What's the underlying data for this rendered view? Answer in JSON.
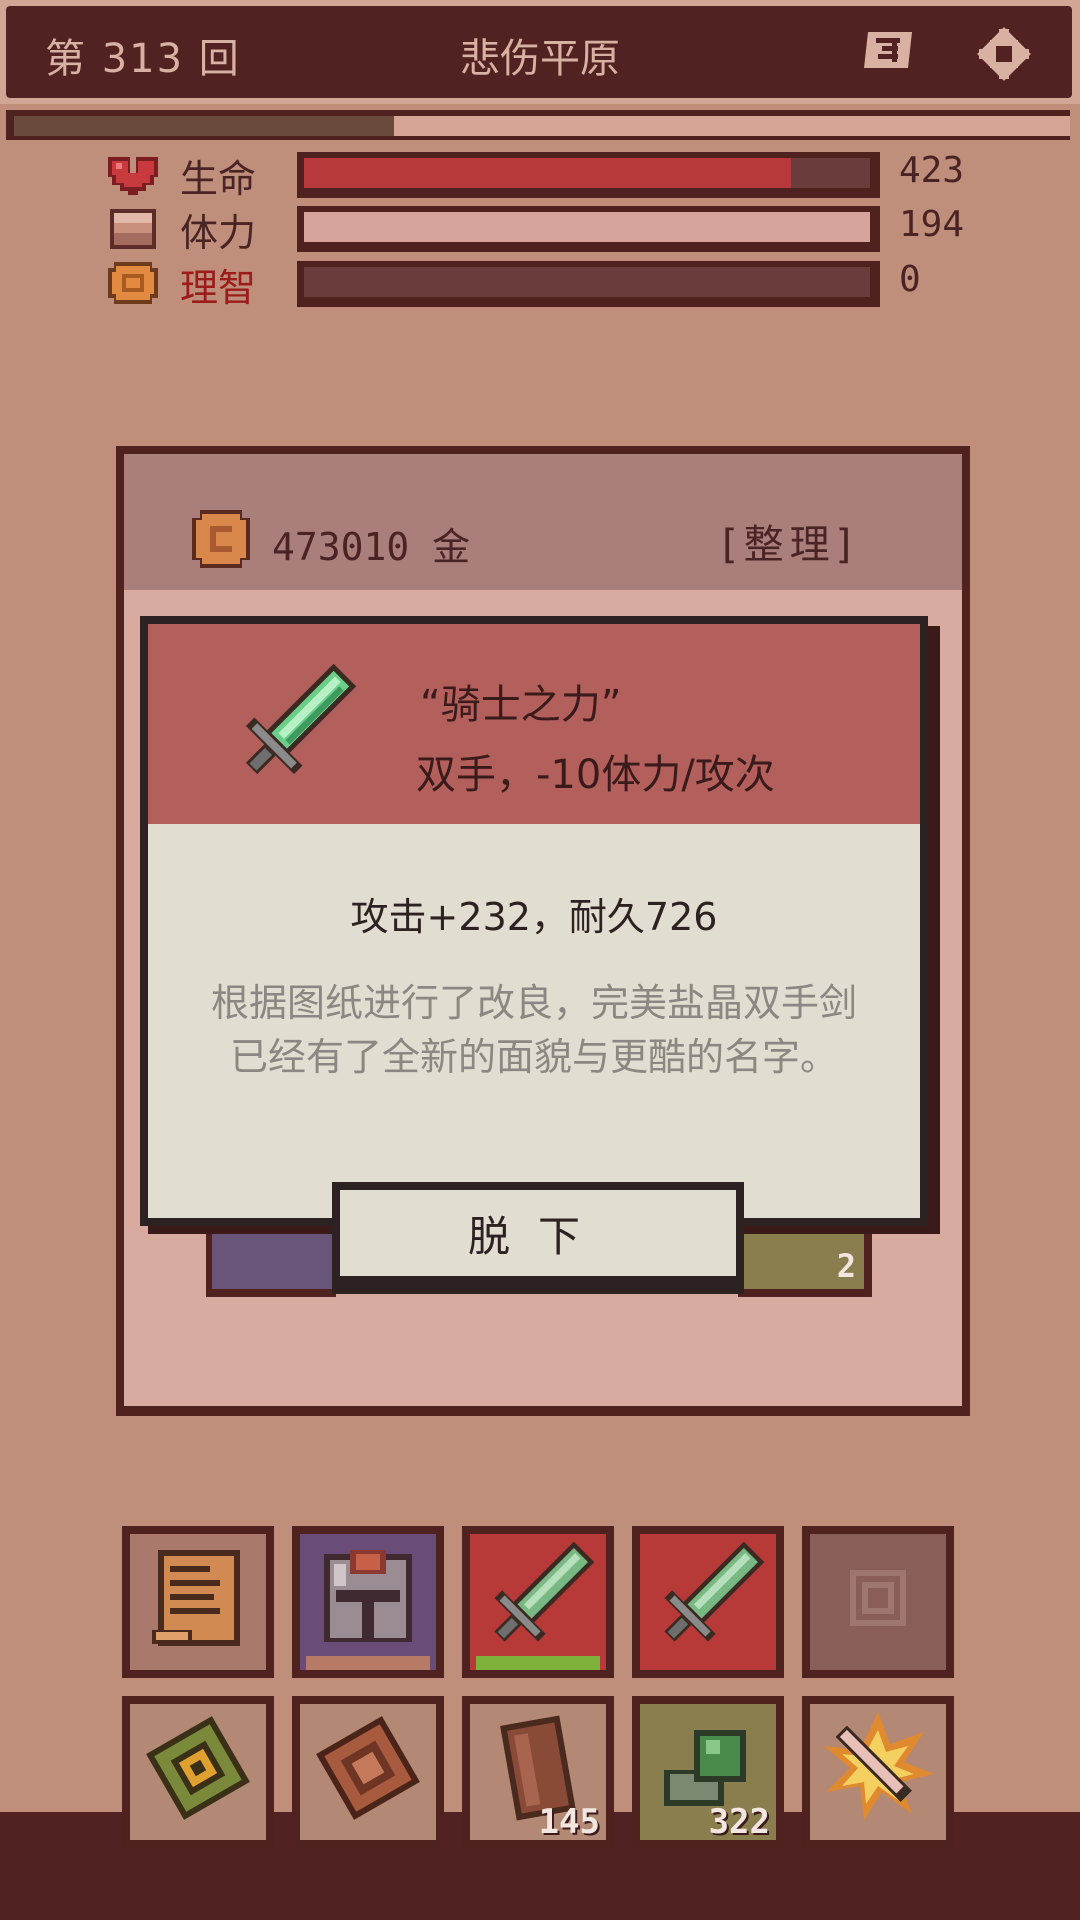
{
  "header": {
    "round_prefix": "第",
    "round_number": "313",
    "round_suffix": "回",
    "location": "悲伤平原",
    "map_icon": "map-icon",
    "settings_icon": "gear-icon"
  },
  "journey_progress": 0.36,
  "stats": [
    {
      "key": "hp",
      "label": "生命",
      "value": "423",
      "fill": 0.86,
      "icon": "heart-icon",
      "fill_color": "#b8393b",
      "back_color": "#6b3c3c",
      "label_color": "#4a2424"
    },
    {
      "key": "stamina",
      "label": "体力",
      "value": "194",
      "fill": 1.0,
      "icon": "stamina-icon",
      "fill_color": "#d6a49b",
      "back_color": "#6b3c3c",
      "label_color": "#4a2424"
    },
    {
      "key": "sanity",
      "label": "理智",
      "value": "0",
      "fill": 0.0,
      "icon": "brain-icon",
      "fill_color": "#b8393b",
      "back_color": "#6b3c3c",
      "label_color": "#9c1b1b"
    }
  ],
  "inventory": {
    "gold": "473010 金",
    "sort_label": "[整理]",
    "hidden_row": [
      {
        "name": "purple-slot",
        "count": ""
      },
      {
        "name": "olive-slot",
        "count": "2"
      }
    ]
  },
  "item_popup": {
    "name": "“骑士之力”",
    "subtitle": "双手，-10体力/攻次",
    "stats": "攻击+232，耐久726",
    "description": "根据图纸进行了改良，完美盐晶双手剑已经有了全新的面貌与更酷的名字。",
    "icon": "green-sword-icon",
    "unequip_label": "脱下"
  },
  "equipment_slots": [
    {
      "icon": "scroll-icon",
      "count": "",
      "bg": "#a97a6c",
      "bar": ""
    },
    {
      "icon": "iron-helmet-icon",
      "count": "",
      "bg": "#6a4c78",
      "bar": "#b77a66"
    },
    {
      "icon": "green-sword-icon",
      "count": "",
      "bg": "#b83a38",
      "bar": "#7fb23a"
    },
    {
      "icon": "green-sword-icon",
      "count": "",
      "bg": "#b83a38",
      "bar": ""
    },
    {
      "icon": "empty-slot-icon",
      "count": "",
      "bg": "#8a5e5a",
      "bar": ""
    }
  ],
  "item_slots": [
    {
      "icon": "rune-book-icon",
      "count": "",
      "bg": "#b38874"
    },
    {
      "icon": "leather-book-icon",
      "count": "",
      "bg": "#b38874"
    },
    {
      "icon": "meat-icon",
      "count": "145",
      "bg": "#b38874"
    },
    {
      "icon": "green-ore-icon",
      "count": "322",
      "bg": "#8a7e4e"
    },
    {
      "icon": "fire-sword-icon",
      "count": "",
      "bg": "#b38874"
    }
  ],
  "colors": {
    "top_bar": "#512221",
    "panel_head": "#a97e7b",
    "panel_bg": "#d9aaa0",
    "popup_head": "#b3605c",
    "popup_body": "#e2ddd1"
  }
}
